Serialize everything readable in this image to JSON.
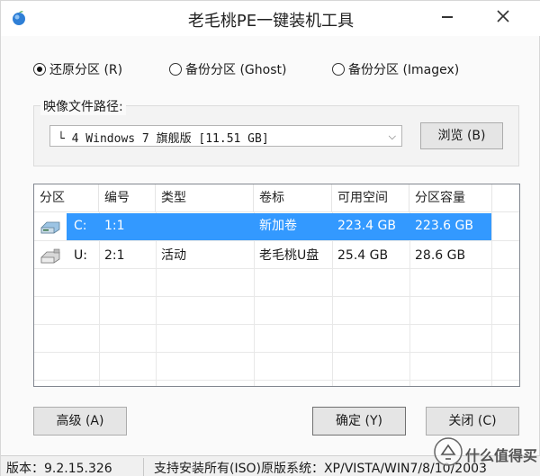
{
  "window": {
    "title": "老毛桃PE一键装机工具",
    "app_icon": "peach-app-icon",
    "minimize_icon": "minimize-icon",
    "close_icon": "close-icon"
  },
  "modes": [
    {
      "label": "还原分区 (R)",
      "selected": true
    },
    {
      "label": "备份分区 (Ghost)",
      "selected": false
    },
    {
      "label": "备份分区 (Imagex)",
      "selected": false
    }
  ],
  "image_path": {
    "group_label": "映像文件路径:",
    "selected_value": "└ 4 Windows 7 旗舰版 [11.51 GB]",
    "browse_label": "浏览 (B)"
  },
  "table": {
    "columns": [
      "分区",
      "编号",
      "类型",
      "卷标",
      "可用空间",
      "分区容量"
    ],
    "rows": [
      {
        "drive": "C:",
        "number": "1:1",
        "type": "",
        "label": "新加卷",
        "free": "223.4 GB",
        "capacity": "223.6 GB",
        "selected": true,
        "icon": "hard-drive-icon"
      },
      {
        "drive": "U:",
        "number": "2:1",
        "type": "活动",
        "label": "老毛桃U盘",
        "free": "25.4 GB",
        "capacity": "28.6 GB",
        "selected": false,
        "icon": "usb-drive-icon"
      }
    ]
  },
  "buttons": {
    "advanced": "高级 (A)",
    "ok": "确定 (Y)",
    "close": "关闭 (C)"
  },
  "status": {
    "version": "版本：9.2.15.326",
    "support": "支持安装所有(ISO)原版系统：XP/VISTA/WIN7/8/10/2003"
  },
  "watermark": {
    "text": "什么值得买",
    "icon": "smzdm-logo-icon"
  },
  "colors": {
    "selection": "#3399ff",
    "close_hover": "#c42b1c"
  }
}
